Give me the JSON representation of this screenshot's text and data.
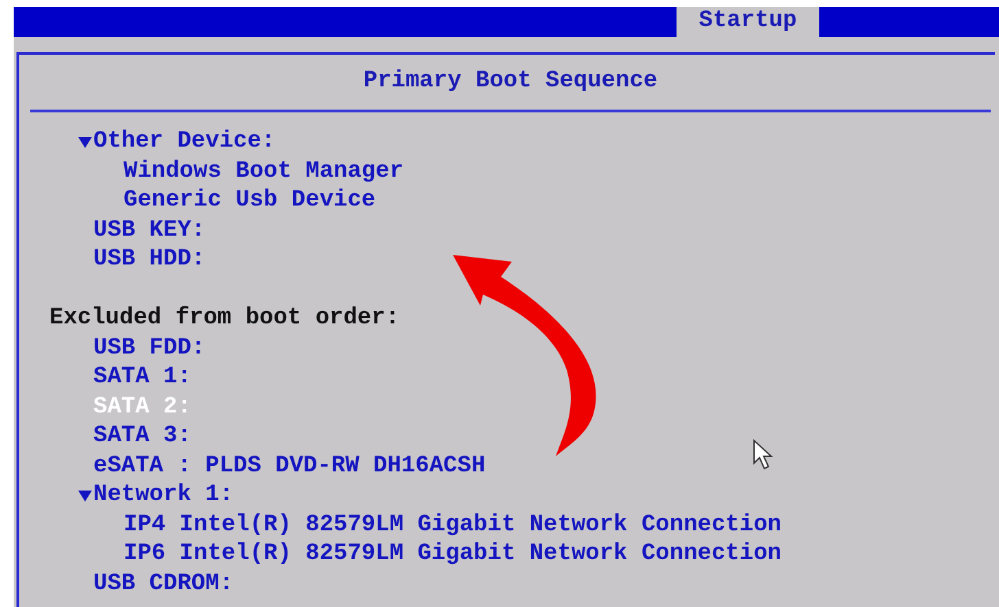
{
  "tab": {
    "label": "Startup",
    "selected": true
  },
  "panel": {
    "title": "Primary Boot Sequence",
    "boot_order": [
      {
        "label": "Other Device:",
        "expanded": true,
        "selected": false,
        "children": [
          {
            "label": "Windows Boot Manager",
            "selected": false
          },
          {
            "label": "Generic Usb Device",
            "selected": false
          }
        ]
      },
      {
        "label": "USB KEY:",
        "selected": false
      },
      {
        "label": "USB HDD:",
        "selected": false
      }
    ],
    "excluded_heading": "Excluded from boot order:",
    "excluded": [
      {
        "label": "USB FDD:",
        "selected": false
      },
      {
        "label": "SATA 1:",
        "selected": false
      },
      {
        "label": "SATA 2:",
        "selected": true
      },
      {
        "label": "SATA 3:",
        "selected": false
      },
      {
        "label": "eSATA : PLDS DVD-RW DH16ACSH",
        "selected": false
      },
      {
        "label": "Network 1:",
        "expanded": true,
        "selected": false,
        "children": [
          {
            "label": "IP4 Intel(R) 82579LM Gigabit Network Connection",
            "selected": false
          },
          {
            "label": "IP6 Intel(R) 82579LM Gigabit Network Connection",
            "selected": false
          }
        ]
      },
      {
        "label": "USB CDROM:",
        "selected": false
      }
    ]
  }
}
